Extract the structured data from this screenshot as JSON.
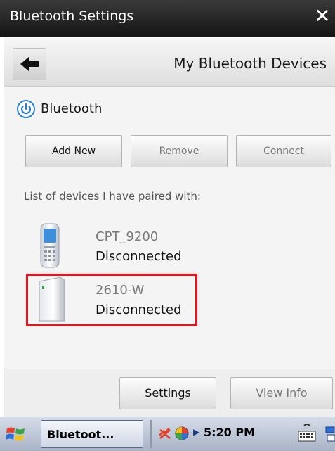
{
  "window": {
    "title": "Bluetooth Settings",
    "close_glyph": "✕"
  },
  "nav": {
    "back_icon": "back-arrow-icon",
    "title": "My Bluetooth Devices"
  },
  "bluetooth": {
    "label": "Bluetooth",
    "icon": "power-icon",
    "accent": "#2a7fd0"
  },
  "actions": {
    "add_new": "Add New",
    "remove": "Remove",
    "connect": "Connect"
  },
  "list": {
    "title": "List of devices I have paired with:"
  },
  "devices": [
    {
      "name": "CPT_9200",
      "status": "Disconnected",
      "icon": "phone-icon"
    },
    {
      "name": "2610-W",
      "status": "Disconnected",
      "icon": "device-tower-icon"
    }
  ],
  "bottom": {
    "settings": "Settings",
    "view_info": "View Info"
  },
  "taskbar": {
    "task_label": "Bluetoot...",
    "time": "5:20 PM"
  },
  "colors": {
    "highlight": "#e8141c"
  }
}
